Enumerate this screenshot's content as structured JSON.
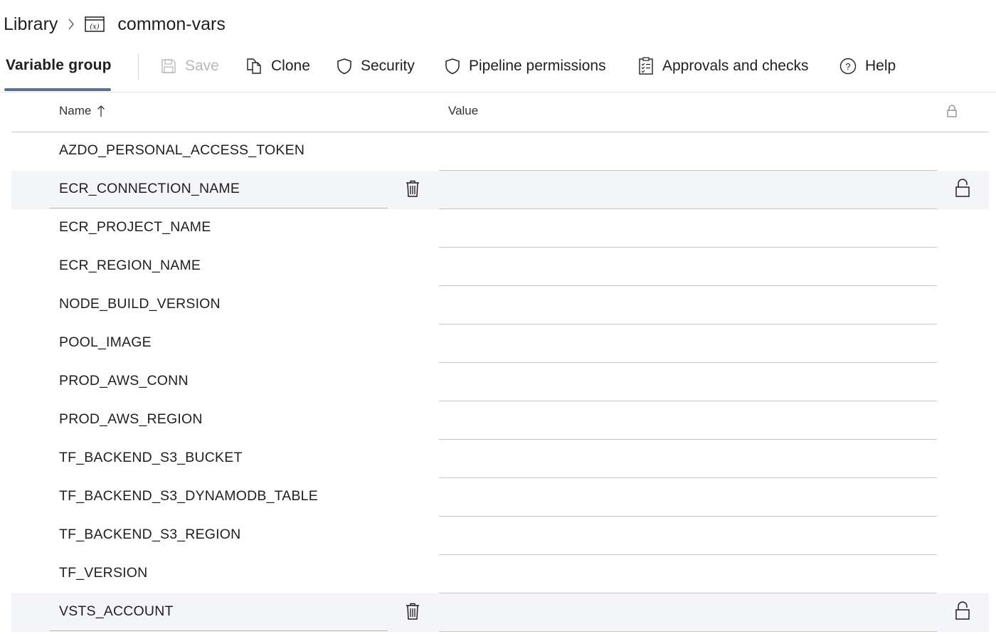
{
  "breadcrumb": {
    "root": "Library",
    "current": "common-vars",
    "icon": "variable-group-icon"
  },
  "toolbar": {
    "active_tab": "Variable group",
    "save": "Save",
    "clone": "Clone",
    "security": "Security",
    "pipeline_permissions": "Pipeline permissions",
    "approvals": "Approvals and checks",
    "help": "Help"
  },
  "table": {
    "col_name": "Name",
    "col_value": "Value",
    "sort_icon": "arrow-up-icon",
    "lock_icon": "lock-icon",
    "rows": [
      {
        "name": "AZDO_PERSONAL_ACCESS_TOKEN",
        "value": "",
        "hover": false
      },
      {
        "name": "ECR_CONNECTION_NAME",
        "value": "",
        "hover": true
      },
      {
        "name": "ECR_PROJECT_NAME",
        "value": "",
        "hover": false
      },
      {
        "name": "ECR_REGION_NAME",
        "value": "",
        "hover": false
      },
      {
        "name": "NODE_BUILD_VERSION",
        "value": "",
        "hover": false
      },
      {
        "name": "POOL_IMAGE",
        "value": "",
        "hover": false
      },
      {
        "name": "PROD_AWS_CONN",
        "value": "",
        "hover": false
      },
      {
        "name": "PROD_AWS_REGION",
        "value": "",
        "hover": false
      },
      {
        "name": "TF_BACKEND_S3_BUCKET",
        "value": "",
        "hover": false
      },
      {
        "name": "TF_BACKEND_S3_DYNAMODB_TABLE",
        "value": "",
        "hover": false
      },
      {
        "name": "TF_BACKEND_S3_REGION",
        "value": "",
        "hover": false
      },
      {
        "name": "TF_VERSION",
        "value": "",
        "hover": false
      },
      {
        "name": "VSTS_ACCOUNT",
        "value": "",
        "hover": true
      }
    ]
  },
  "colors": {
    "accent_underline": "#5f6f8a",
    "hover_row": "#f3f5f8",
    "text": "#201f1e",
    "disabled": "#b8b8b8"
  }
}
